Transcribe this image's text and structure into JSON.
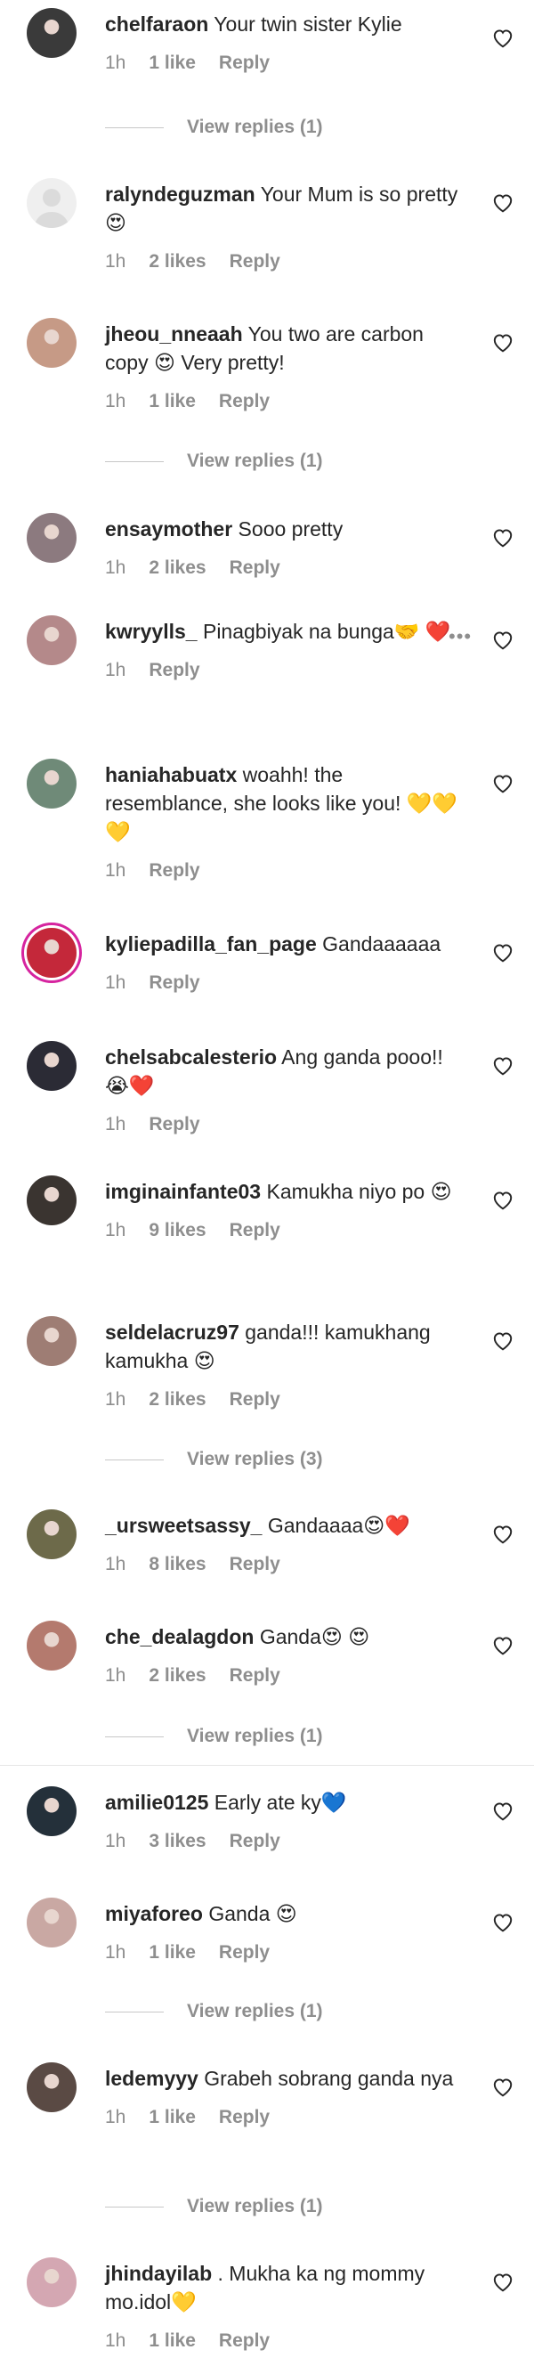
{
  "colors": {
    "text": "#262626",
    "meta": "#8e8e8e",
    "ring": "#d6249f"
  },
  "comments": [
    {
      "user": "chelfaraon",
      "text": " Your twin sister Kylie",
      "time": "1h",
      "likes": "1 like",
      "reply": "Reply",
      "view_replies": "View replies (1)",
      "avatar_color": "#3a3a3a"
    },
    {
      "user": "ralyndeguzman",
      "text": " Your Mum is so pretty😍",
      "time": "1h",
      "likes": "2 likes",
      "reply": "Reply",
      "view_replies": "",
      "avatar_color": "#dbdbdb",
      "avatar_default": true
    },
    {
      "user": "jheou_nneaah",
      "text": " You two are carbon copy 😍 Very pretty!",
      "time": "1h",
      "likes": "1 like",
      "reply": "Reply",
      "view_replies": "View replies (1)",
      "avatar_color": "#c69a86"
    },
    {
      "user": "ensaymother",
      "text": " Sooo pretty",
      "time": "1h",
      "likes": "2 likes",
      "reply": "Reply",
      "view_replies": "",
      "avatar_color": "#8c7a7f"
    },
    {
      "user": "kwryylls_",
      "text": " Pinagbiyak na bunga🤝 ❤️",
      "time": "1h",
      "likes": "",
      "reply": "Reply",
      "view_replies": "",
      "avatar_color": "#b4898a",
      "dots": "•••"
    },
    {
      "user": "haniahabuatx",
      "text": " woahh! the resemblance, she looks like you! 💛💛💛",
      "time": "1h",
      "likes": "",
      "reply": "Reply",
      "view_replies": "",
      "avatar_color": "#6f8a78"
    },
    {
      "user": "kyliepadilla_fan_page",
      "text": " Gandaaaaaa",
      "time": "1h",
      "likes": "",
      "reply": "Reply",
      "view_replies": "",
      "avatar_color": "#c4283a",
      "ring": true
    },
    {
      "user": "chelsabcalesterio",
      "text": " Ang ganda pooo!! 😭❤️",
      "time": "1h",
      "likes": "",
      "reply": "Reply",
      "view_replies": "",
      "avatar_color": "#2b2b35"
    },
    {
      "user": "imginainfante03",
      "text": " Kamukha niyo po 😍",
      "time": "1h",
      "likes": "9 likes",
      "reply": "Reply",
      "view_replies": "",
      "avatar_color": "#3a3430"
    },
    {
      "user": "seldelacruz97",
      "text": " ganda!!! kamukhang kamukha 😍",
      "time": "1h",
      "likes": "2 likes",
      "reply": "Reply",
      "view_replies": "View replies (3)",
      "avatar_color": "#9e7d74"
    },
    {
      "user": "_ursweetsassy_",
      "text": " Gandaaaa😍❤️",
      "time": "1h",
      "likes": "8 likes",
      "reply": "Reply",
      "view_replies": "",
      "avatar_color": "#6d6a4a"
    },
    {
      "user": "che_dealagdon",
      "text": " Ganda😍 😍",
      "time": "1h",
      "likes": "2 likes",
      "reply": "Reply",
      "view_replies": "View replies (1)",
      "avatar_color": "#b47a6e"
    },
    {
      "user": "amilie0125",
      "text": " Early ate ky💙",
      "time": "1h",
      "likes": "3 likes",
      "reply": "Reply",
      "view_replies": "",
      "avatar_color": "#24303a"
    },
    {
      "user": "miyaforeo",
      "text": " Ganda 😍",
      "time": "1h",
      "likes": "1 like",
      "reply": "Reply",
      "view_replies": "View replies (1)",
      "avatar_color": "#c9a8a3"
    },
    {
      "user": "ledemyyy",
      "text": " Grabeh sobrang ganda nya",
      "time": "1h",
      "likes": "1 like",
      "reply": "Reply",
      "view_replies": "View replies (1)",
      "avatar_color": "#5a4a44"
    },
    {
      "user": "jhindayilab",
      "text": " . Mukha ka ng mommy mo.idol💛",
      "time": "1h",
      "likes": "1 like",
      "reply": "Reply",
      "view_replies": "",
      "avatar_color": "#d4a7b2"
    }
  ]
}
